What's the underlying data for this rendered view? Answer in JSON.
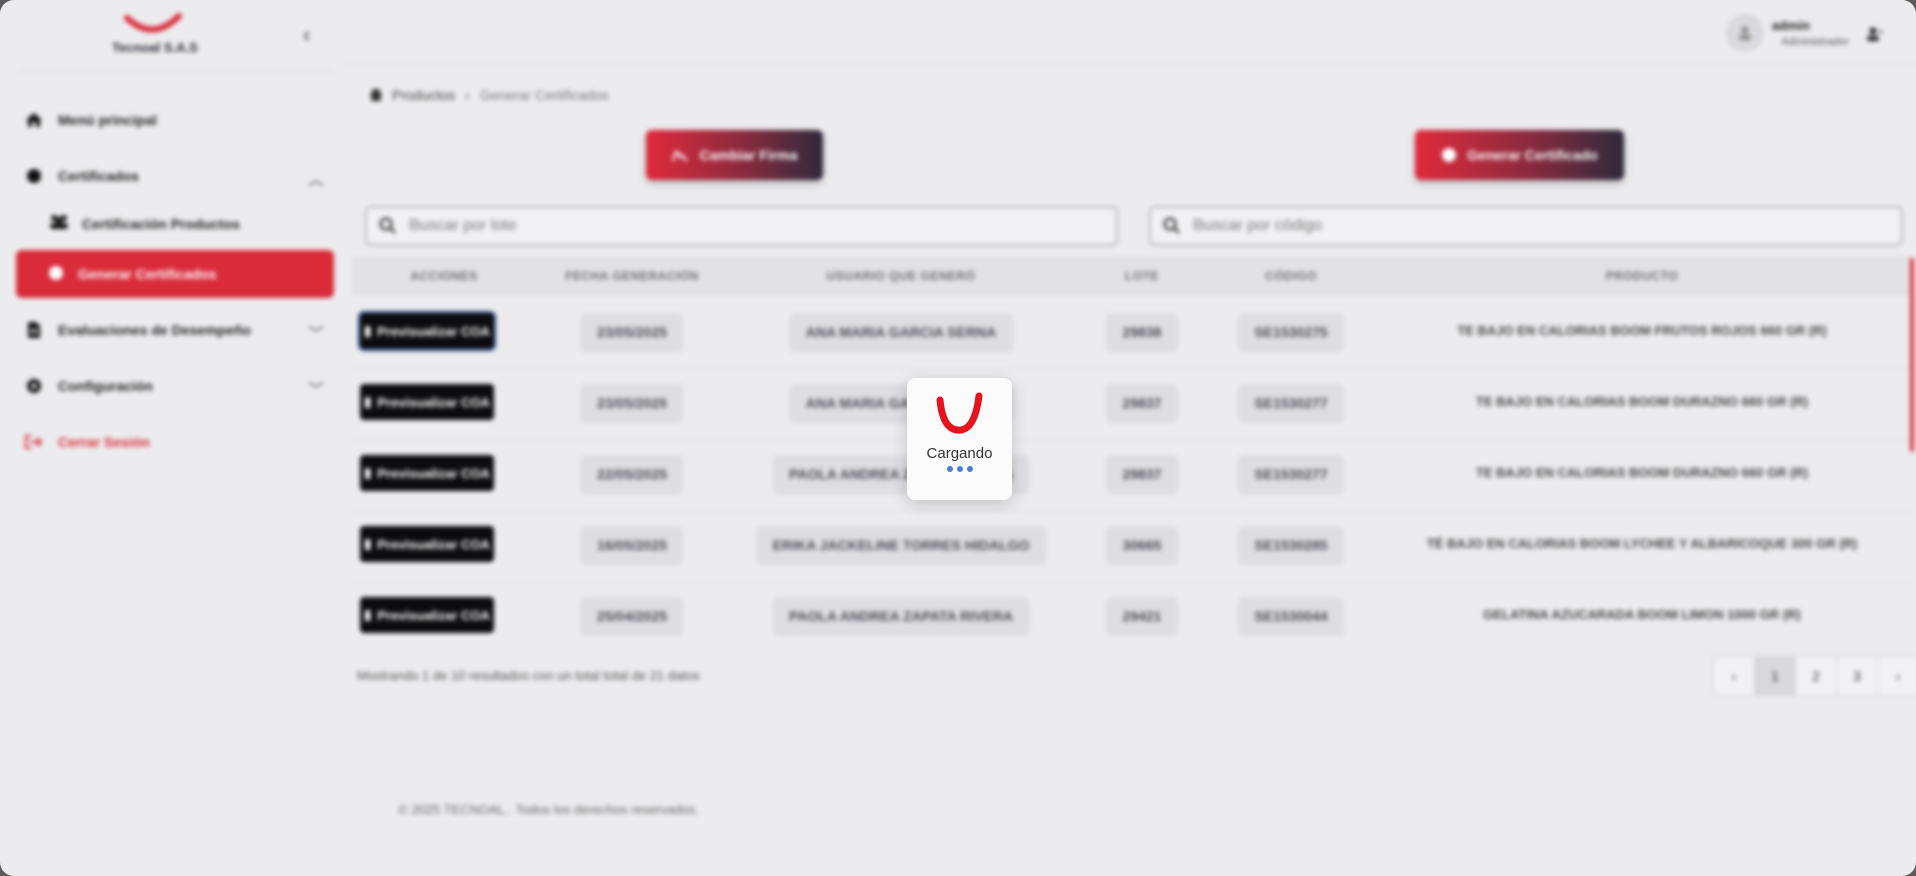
{
  "brand": {
    "name": "Tecnoal S.A.S",
    "color": "#d92b3a"
  },
  "sidebar": {
    "items": [
      {
        "label": "Menú principal",
        "icon": "home-icon"
      },
      {
        "label": "Certificados",
        "icon": "circle-icon"
      },
      {
        "label": "Certificación Productos",
        "icon": "users-icon"
      },
      {
        "label": "Generar Certificados",
        "icon": "circle-icon"
      },
      {
        "label": "Evaluaciones de Desempeño",
        "icon": "document-icon"
      },
      {
        "label": "Configuración",
        "icon": "gear-icon"
      },
      {
        "label": "Cerrar Sesión",
        "icon": "logout-icon"
      }
    ]
  },
  "header": {
    "user_name": "admin",
    "user_role": "Administrador"
  },
  "breadcrumb": {
    "parent": "Productos",
    "current": "Generar Certificados"
  },
  "actions": {
    "change_signature": "Cambiar Firma",
    "generate_certificate": "Generar Certificado"
  },
  "search": {
    "lot_placeholder": "Buscar por lote",
    "code_placeholder": "Buscar por código"
  },
  "table": {
    "columns": [
      "ACCIONES",
      "FECHA GENERACIÓN",
      "USUARIO QUE GENERÓ",
      "LOTE",
      "CÓDIGO",
      "PRODUCTO"
    ],
    "preview_label": "Previsualizar COA",
    "rows": [
      {
        "date": "23/05/2025",
        "user": "ANA MARIA GARCIA SERNA",
        "lot": "29838",
        "code": "SE1530275",
        "product": "TE BAJO EN CALORIAS BOOM FRUTOS ROJOS 660 GR (R)"
      },
      {
        "date": "23/05/2025",
        "user": "ANA MARIA GARCIA SERNA",
        "lot": "29837",
        "code": "SE1530277",
        "product": "TE BAJO EN CALORIAS BOOM DURAZNO 660 GR (R)"
      },
      {
        "date": "22/05/2025",
        "user": "PAOLA ANDREA ZAPATA RIVERA",
        "lot": "29837",
        "code": "SE1530277",
        "product": "TE BAJO EN CALORIAS BOOM DURAZNO 660 GR (R)"
      },
      {
        "date": "16/05/2025",
        "user": "ERIKA JACKELINE TORRES HIDALGO",
        "lot": "30665",
        "code": "SE1530285",
        "product": "TÉ BAJO EN CALORIAS BOOM LYCHEE Y ALBARICOQUE 300 GR (R)"
      },
      {
        "date": "25/04/2025",
        "user": "PAOLA ANDREA ZAPATA RIVERA",
        "lot": "29421",
        "code": "SE1530044",
        "product": "GELATINA AZUCARADA BOOM LIMON 1000 GR (R)"
      }
    ]
  },
  "summary": "Mostrando 1 de 10 resultados con un total total de 21 datos",
  "pagination": {
    "pages": [
      "1",
      "2",
      "3"
    ],
    "current": "1"
  },
  "footer": "© 2025 TECNOAL.. Todos los derechos reservados.",
  "loader": {
    "text": "Cargando"
  }
}
